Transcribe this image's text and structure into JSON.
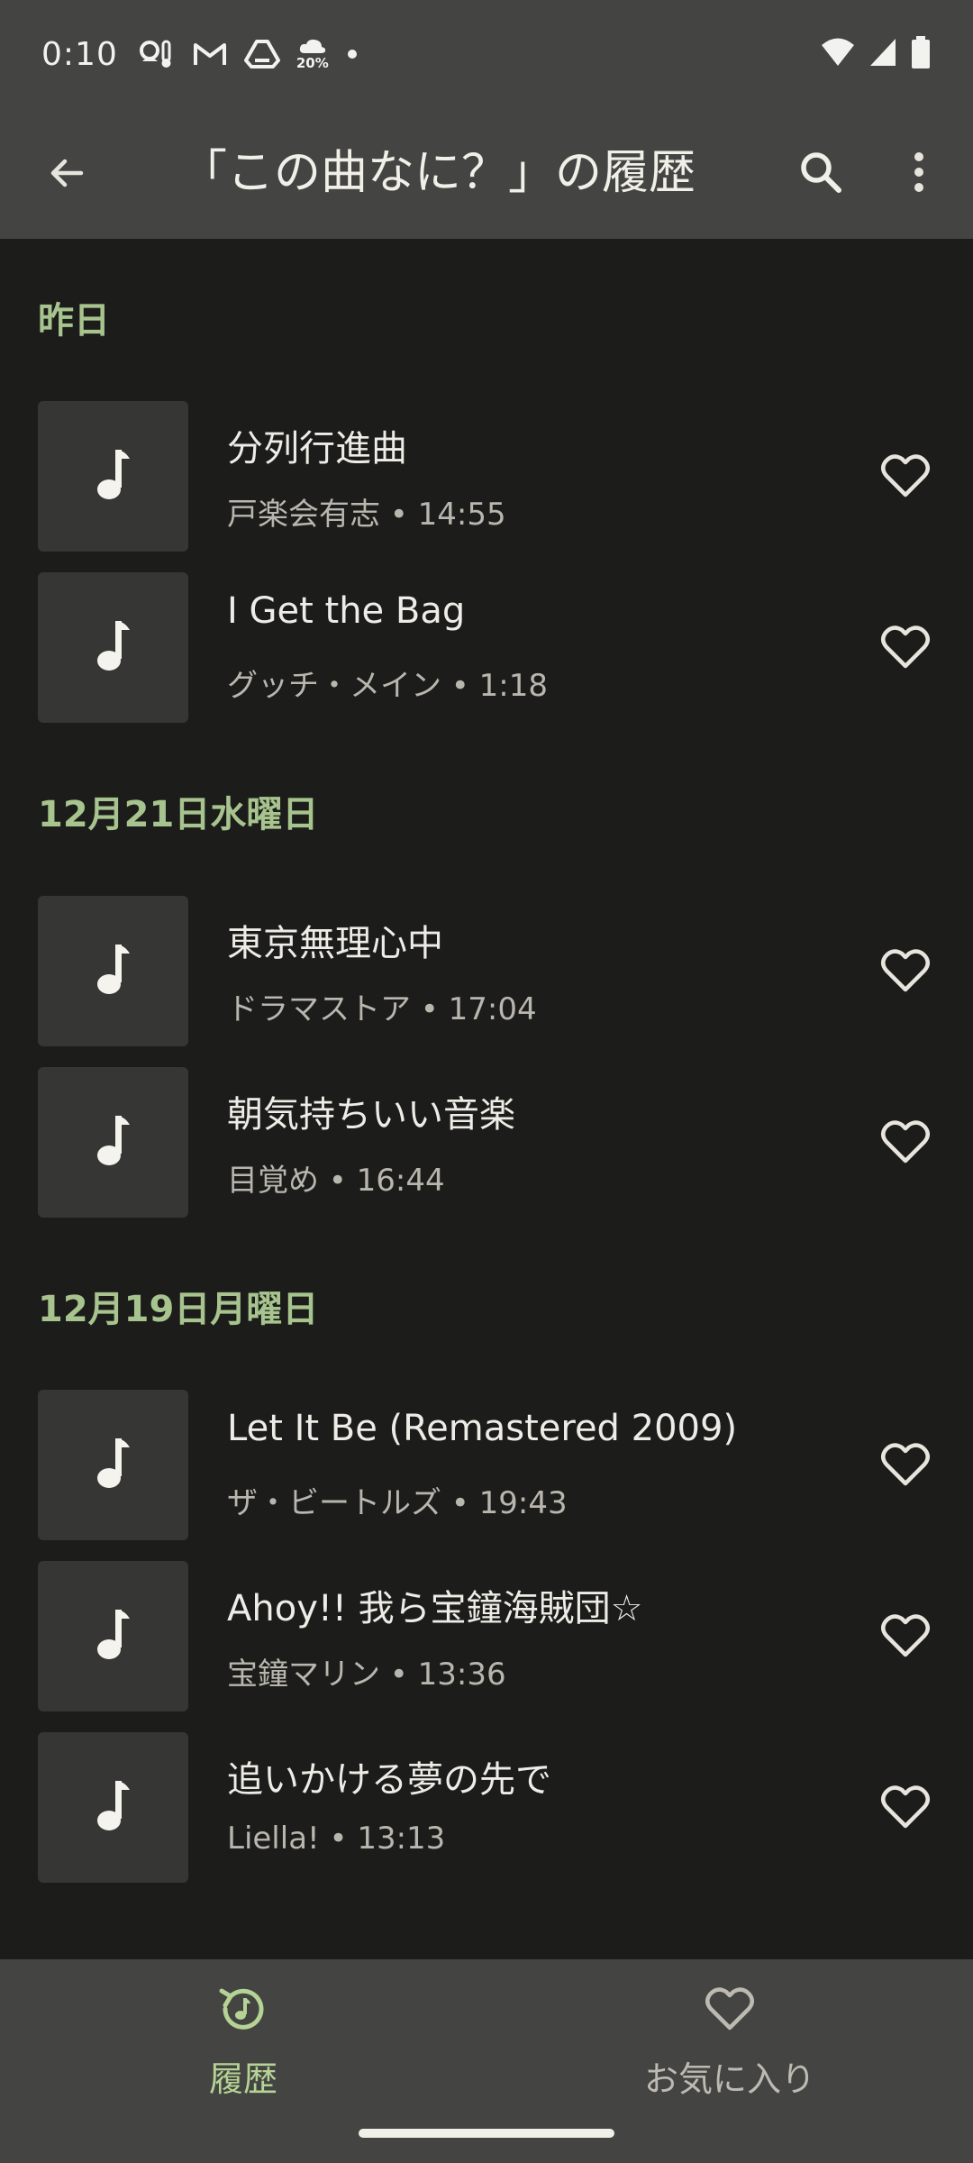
{
  "status_bar": {
    "time": "0:10",
    "icons": [
      "weather-thermo-icon",
      "gmail-icon",
      "drive-icon",
      "rain-20-icon",
      "dot-icon"
    ],
    "rain_percent": "20%",
    "right_icons": [
      "wifi-icon",
      "signal-icon",
      "battery-icon"
    ]
  },
  "app_bar": {
    "title": "「この曲なに？」の履歴",
    "back_icon": "arrow-back-icon",
    "search_icon": "search-icon",
    "more_icon": "more-vert-icon"
  },
  "sections": [
    {
      "header": "昨日",
      "tracks": [
        {
          "title": "分列行進曲",
          "meta": "戸楽会有志 • 14:55"
        },
        {
          "title": "I Get the Bag",
          "meta": "グッチ・メイン • 1:18"
        }
      ]
    },
    {
      "header": "12月21日水曜日",
      "tracks": [
        {
          "title": "東京無理心中",
          "meta": "ドラマストア • 17:04"
        },
        {
          "title": "朝気持ちいい音楽",
          "meta": "目覚め • 16:44"
        }
      ]
    },
    {
      "header": "12月19日月曜日",
      "tracks": [
        {
          "title": "Let It Be (Remastered 2009)",
          "meta": "ザ・ビートルズ • 19:43"
        },
        {
          "title": "Ahoy!! 我ら宝鐘海賊団☆",
          "meta": "宝鐘マリン • 13:36"
        },
        {
          "title": "追いかける夢の先で",
          "meta": "Liella! • 13:13"
        }
      ]
    }
  ],
  "bottom_nav": {
    "history_label": "履歴",
    "favorites_label": "お気に入り"
  },
  "colors": {
    "accent": "#a7c48e",
    "background": "#1c1c1a",
    "bar": "#444442"
  }
}
